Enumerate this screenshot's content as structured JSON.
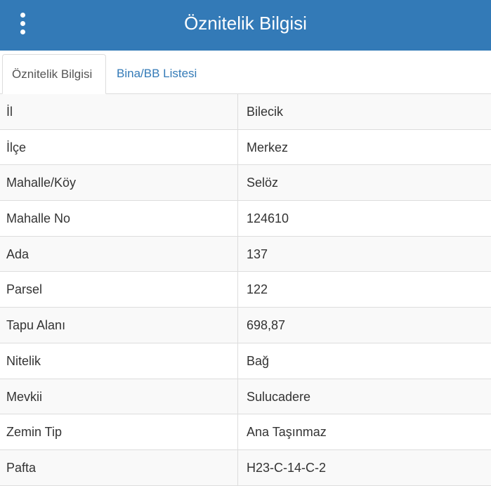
{
  "header": {
    "title": "Öznitelik Bilgisi",
    "menu_icon": "more-vertical-icon",
    "background": "#337ab7"
  },
  "tabs": [
    {
      "label": "Öznitelik Bilgisi",
      "active": true
    },
    {
      "label": "Bina/BB Listesi",
      "active": false
    }
  ],
  "attributes": [
    {
      "key": "İl",
      "value": "Bilecik"
    },
    {
      "key": "İlçe",
      "value": "Merkez"
    },
    {
      "key": "Mahalle/Köy",
      "value": "Selöz"
    },
    {
      "key": "Mahalle No",
      "value": "124610"
    },
    {
      "key": "Ada",
      "value": "137"
    },
    {
      "key": "Parsel",
      "value": "122"
    },
    {
      "key": "Tapu Alanı",
      "value": "698,87"
    },
    {
      "key": "Nitelik",
      "value": "Bağ"
    },
    {
      "key": "Mevkii",
      "value": "Sulucadere"
    },
    {
      "key": "Zemin Tip",
      "value": "Ana Taşınmaz"
    },
    {
      "key": "Pafta",
      "value": "H23-C-14-C-2"
    }
  ]
}
